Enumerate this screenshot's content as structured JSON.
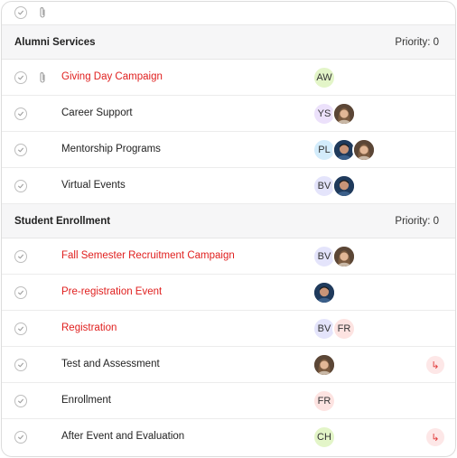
{
  "colors": {
    "accent_red": "#e0201f",
    "avatar_green": "#e3f5c8",
    "avatar_purple": "#ece1fb",
    "avatar_blue": "#d3ecfb",
    "avatar_lavender": "#e4e4fb",
    "avatar_pink": "#fde3e1"
  },
  "toolbar": {
    "icons": [
      "check-circle-icon",
      "paperclip-icon"
    ]
  },
  "groups": [
    {
      "title": "Alumni Services",
      "priority": "Priority: 0",
      "tasks": [
        {
          "name": "Giving Day Campaign",
          "highlight": true,
          "attachment": true,
          "assignees": [
            {
              "initials": "AW",
              "color": "#e3f5c8"
            }
          ]
        },
        {
          "name": "Career Support",
          "highlight": false,
          "assignees": [
            {
              "initials": "YS",
              "color": "#ece1fb"
            },
            {
              "photo": "woman"
            }
          ]
        },
        {
          "name": "Mentorship Programs",
          "highlight": false,
          "assignees": [
            {
              "initials": "PL",
              "color": "#d3ecfb"
            },
            {
              "photo": "man"
            },
            {
              "photo": "woman"
            }
          ]
        },
        {
          "name": "Virtual Events",
          "highlight": false,
          "assignees": [
            {
              "initials": "BV",
              "color": "#e4e4fb"
            },
            {
              "photo": "man"
            }
          ]
        }
      ]
    },
    {
      "title": "Student Enrollment",
      "priority": "Priority: 0",
      "tasks": [
        {
          "name": "Fall Semester Recruitment Campaign",
          "highlight": true,
          "assignees": [
            {
              "initials": "BV",
              "color": "#e4e4fb"
            },
            {
              "photo": "woman"
            }
          ]
        },
        {
          "name": "Pre-registration Event",
          "highlight": true,
          "assignees": [
            {
              "photo": "man"
            }
          ]
        },
        {
          "name": "Registration",
          "highlight": true,
          "assignees": [
            {
              "initials": "BV",
              "color": "#e4e4fb"
            },
            {
              "initials": "FR",
              "color": "#fde3e1"
            }
          ]
        },
        {
          "name": "Test and Assessment",
          "highlight": false,
          "subtask": true,
          "assignees": [
            {
              "photo": "woman"
            }
          ]
        },
        {
          "name": "Enrollment",
          "highlight": false,
          "assignees": [
            {
              "initials": "FR",
              "color": "#fde3e1"
            }
          ]
        },
        {
          "name": "After Event and Evaluation",
          "highlight": false,
          "subtask": true,
          "assignees": [
            {
              "initials": "CH",
              "color": "#e3f5c8"
            }
          ]
        }
      ]
    }
  ]
}
